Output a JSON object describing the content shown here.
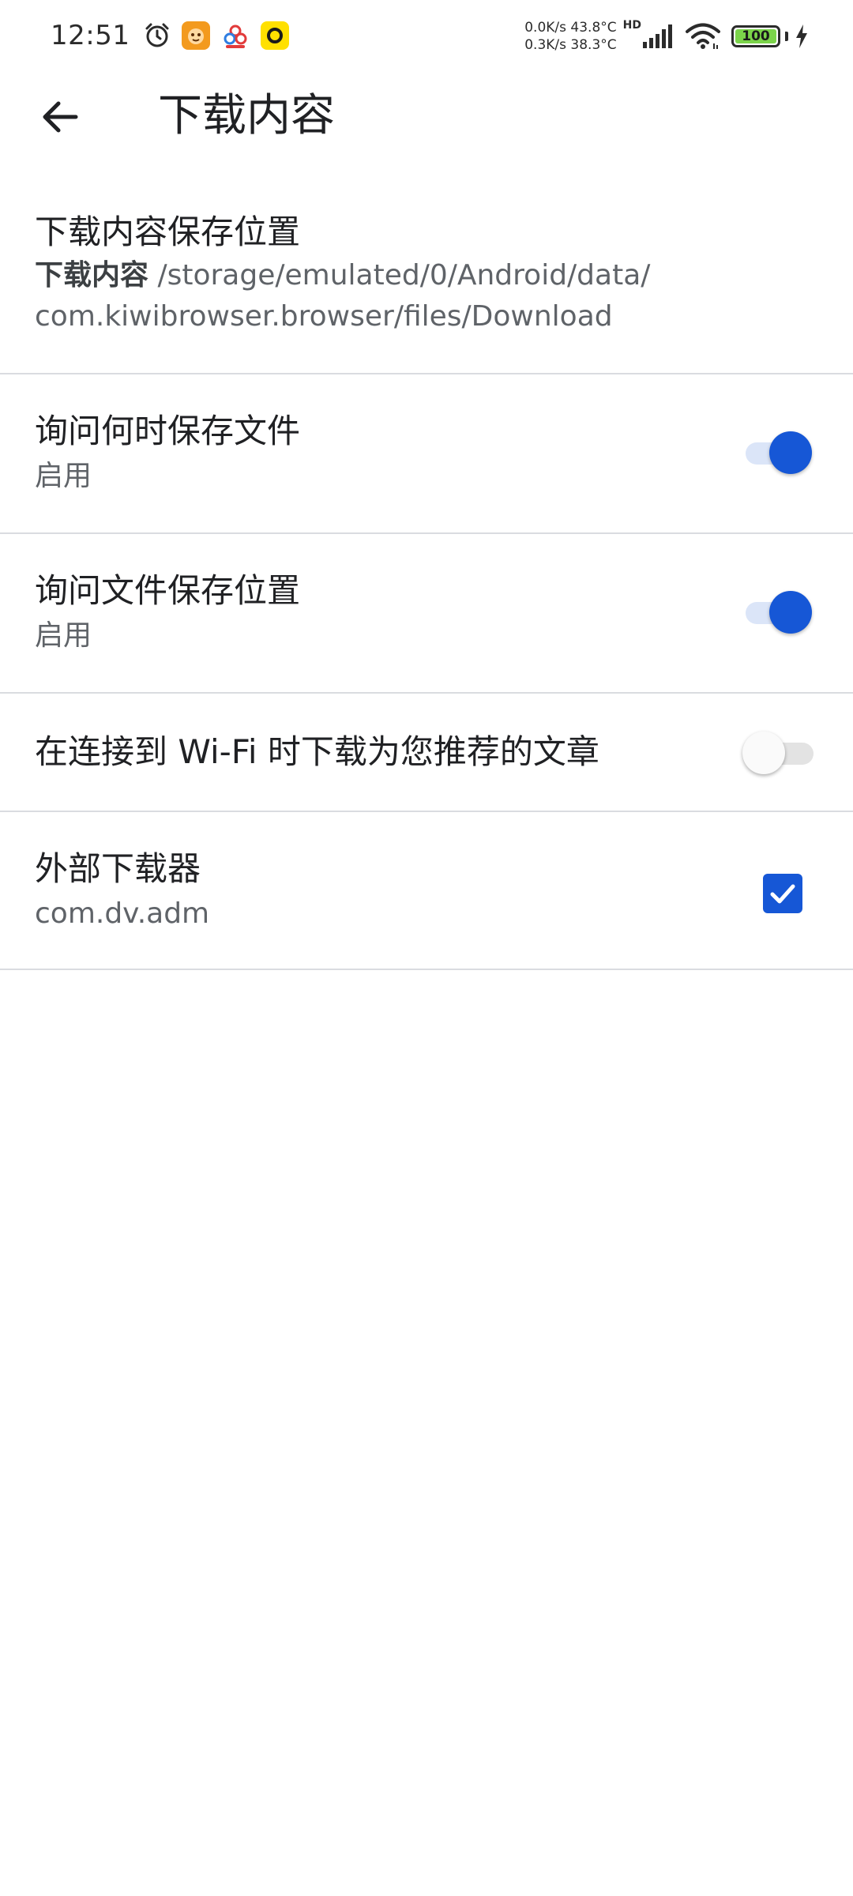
{
  "status_bar": {
    "time": "12:51",
    "net_up": "0.0K/s",
    "net_down": "0.3K/s",
    "temp_1": "43.8°C",
    "temp_2": "38.3°C",
    "network_type": "HD",
    "battery_level": "100",
    "battery_fraction": 1.0,
    "battery_color": "#7bd44a",
    "icons": [
      "alarm-icon",
      "orange-app-icon",
      "colorful-app-icon",
      "yellow-app-icon",
      "signal-icon",
      "wifi-icon",
      "battery-icon",
      "charging-bolt-icon"
    ]
  },
  "app_bar": {
    "back_icon": "arrow-back-icon",
    "title": "下载内容"
  },
  "preferences": {
    "location": {
      "title": "下载内容保存位置",
      "summary_bold": "下载内容",
      "summary_path_line1": "/storage/emulated/0/Android/data/",
      "summary_path_line2": "com.kiwibrowser.browser/files/Download"
    },
    "ask_when_save": {
      "title": "询问何时保存文件",
      "summary": "启用",
      "checked": true
    },
    "ask_where_save": {
      "title": "询问文件保存位置",
      "summary": "启用",
      "checked": true
    },
    "wifi_download": {
      "title": "在连接到 Wi-Fi 时下载为您推荐的文章",
      "checked": false
    },
    "external_downloader": {
      "title": "外部下载器",
      "summary": "com.dv.adm",
      "checked": true
    }
  },
  "colors": {
    "accent": "#1657d6",
    "accent_track": "#dbe5f8",
    "divider": "#dadce0",
    "text_primary": "#202124",
    "text_secondary": "#5f6368"
  }
}
